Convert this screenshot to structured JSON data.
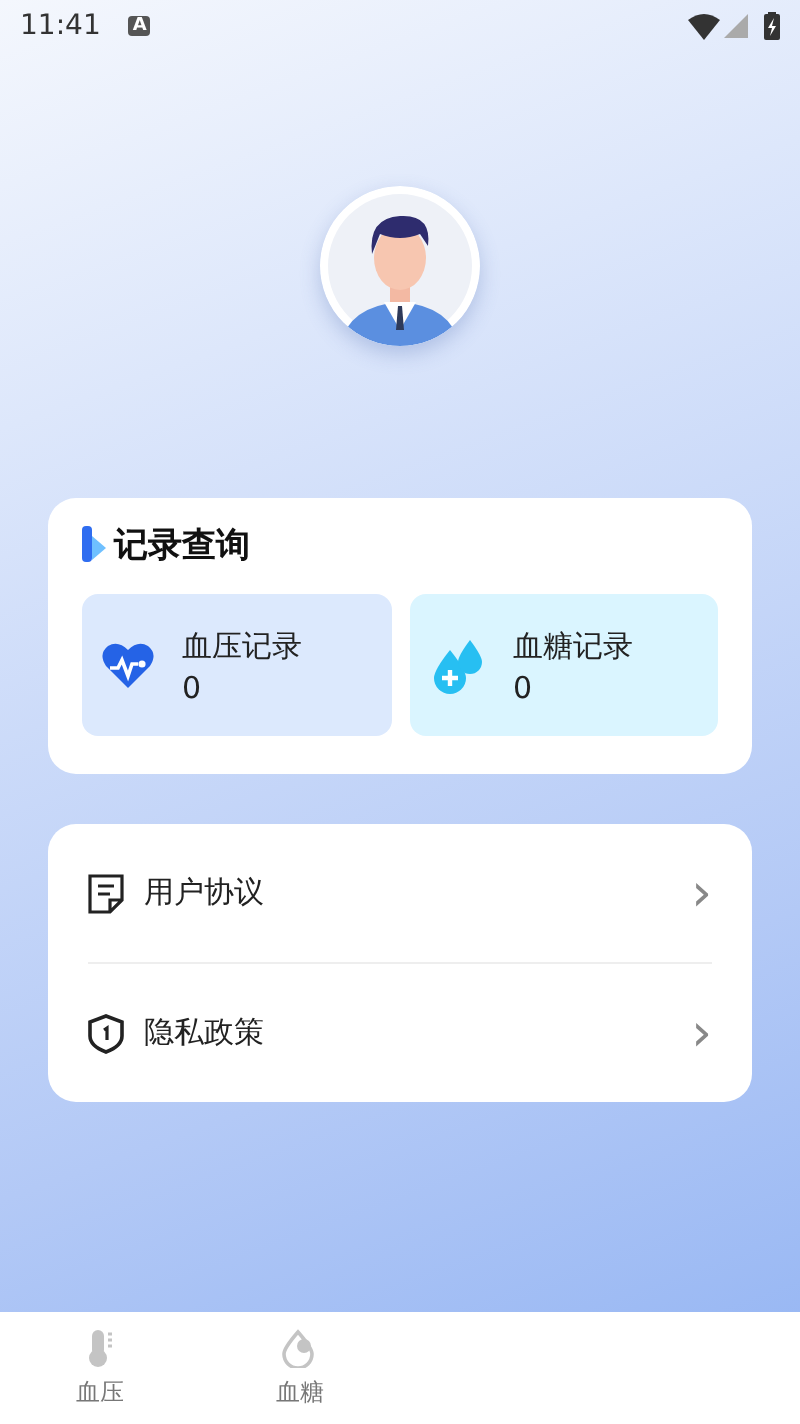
{
  "status_bar": {
    "time": "11:41",
    "notification": "A"
  },
  "records": {
    "title": "记录查询",
    "items": [
      {
        "kind": "pressure",
        "label": "血压记录",
        "count": "0"
      },
      {
        "kind": "sugar",
        "label": "血糖记录",
        "count": "0"
      }
    ]
  },
  "menu": [
    {
      "kind": "agreement",
      "label": "用户协议",
      "chevron": "›"
    },
    {
      "kind": "privacy",
      "label": "隐私政策",
      "chevron": "›"
    }
  ],
  "tabs": [
    {
      "kind": "pressure",
      "label": "血压",
      "selected": false
    },
    {
      "kind": "sugar",
      "label": "血糖",
      "selected": false
    }
  ]
}
